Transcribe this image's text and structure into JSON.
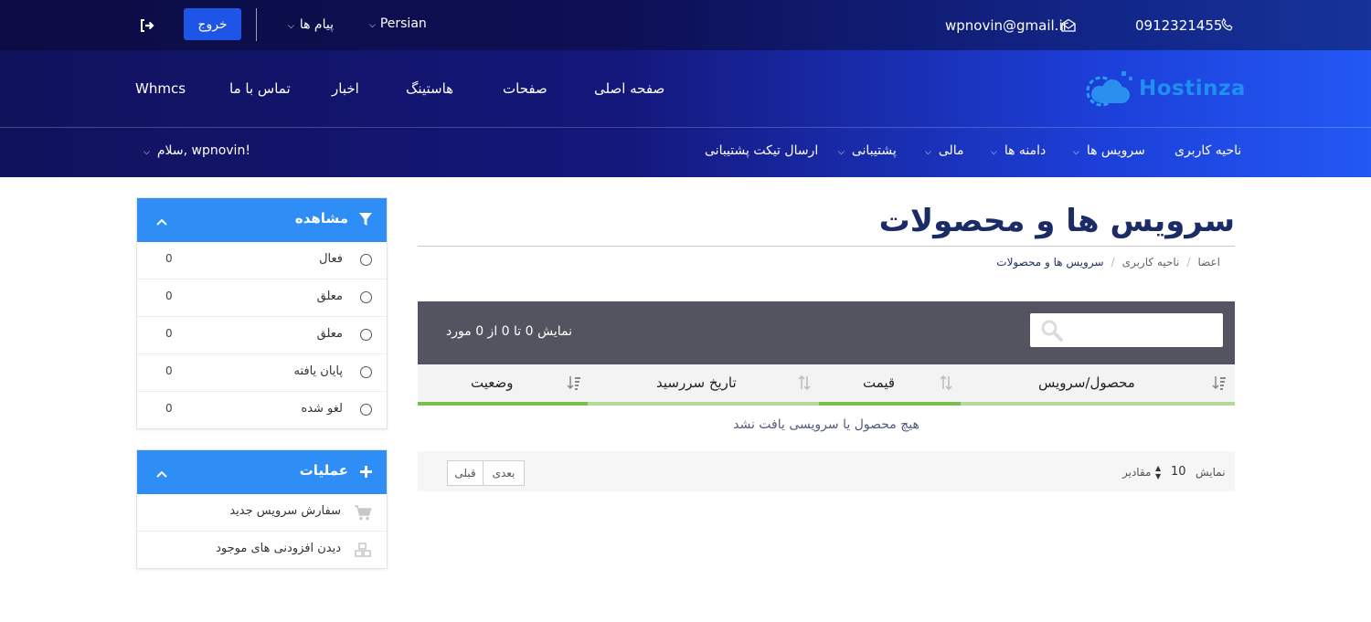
{
  "topbar": {
    "phone": "0912321455",
    "email": "wpnovin@gmail.ir",
    "language": "Persian",
    "messages": "پیام ها",
    "logout_label": "خروج"
  },
  "logo": {
    "text": "Hostinza"
  },
  "main_nav": [
    "صفحه اصلی",
    "صفحات",
    "هاستینگ",
    "اخبار",
    "تماس با ما",
    "Whmcs"
  ],
  "client_nav": {
    "items": [
      "ناحیه کاربری",
      "سرویس ها",
      "دامنه ها",
      "مالی",
      "پشتیبانی",
      "ارسال تیکت پشتیبانی"
    ],
    "greeting": "سلام, wpnovin!"
  },
  "page": {
    "title": "سرویس ها و محصولات",
    "breadcrumb": [
      "اعضا",
      "ناحیه کاربری",
      "سرویس ها و محصولات"
    ]
  },
  "table": {
    "search_placeholder": "",
    "info": "نمایش 0 تا 0 از 0 مورد",
    "columns": [
      "محصول/سرویس",
      "قیمت",
      "تاریخ سررسید",
      "وضعیت"
    ],
    "empty_message": "هیچ محصول یا سرویسی یافت نشد",
    "length_prefix": "نمایش",
    "length_value": "10",
    "length_suffix": "مقادیر",
    "next_label": "بعدی",
    "prev_label": "قبلی"
  },
  "filter_panel": {
    "title": "مشاهده",
    "items": [
      {
        "label": "فعال",
        "count": "0"
      },
      {
        "label": "معلق",
        "count": "0"
      },
      {
        "label": "معلق",
        "count": "0"
      },
      {
        "label": "پایان یافته",
        "count": "0"
      },
      {
        "label": "لغو شده",
        "count": "0"
      }
    ]
  },
  "actions_panel": {
    "title": "عملیات",
    "items": [
      {
        "label": "سفارش سرویس جدید",
        "icon": "cart-icon"
      },
      {
        "label": "دیدن افزودنی های موجود",
        "icon": "cubes-icon"
      }
    ]
  },
  "colors": {
    "panel_header": "#2e8ef5",
    "table_header": "#535460",
    "logout_button": "#1f55e6",
    "column_accent": "#7bbf4f"
  }
}
